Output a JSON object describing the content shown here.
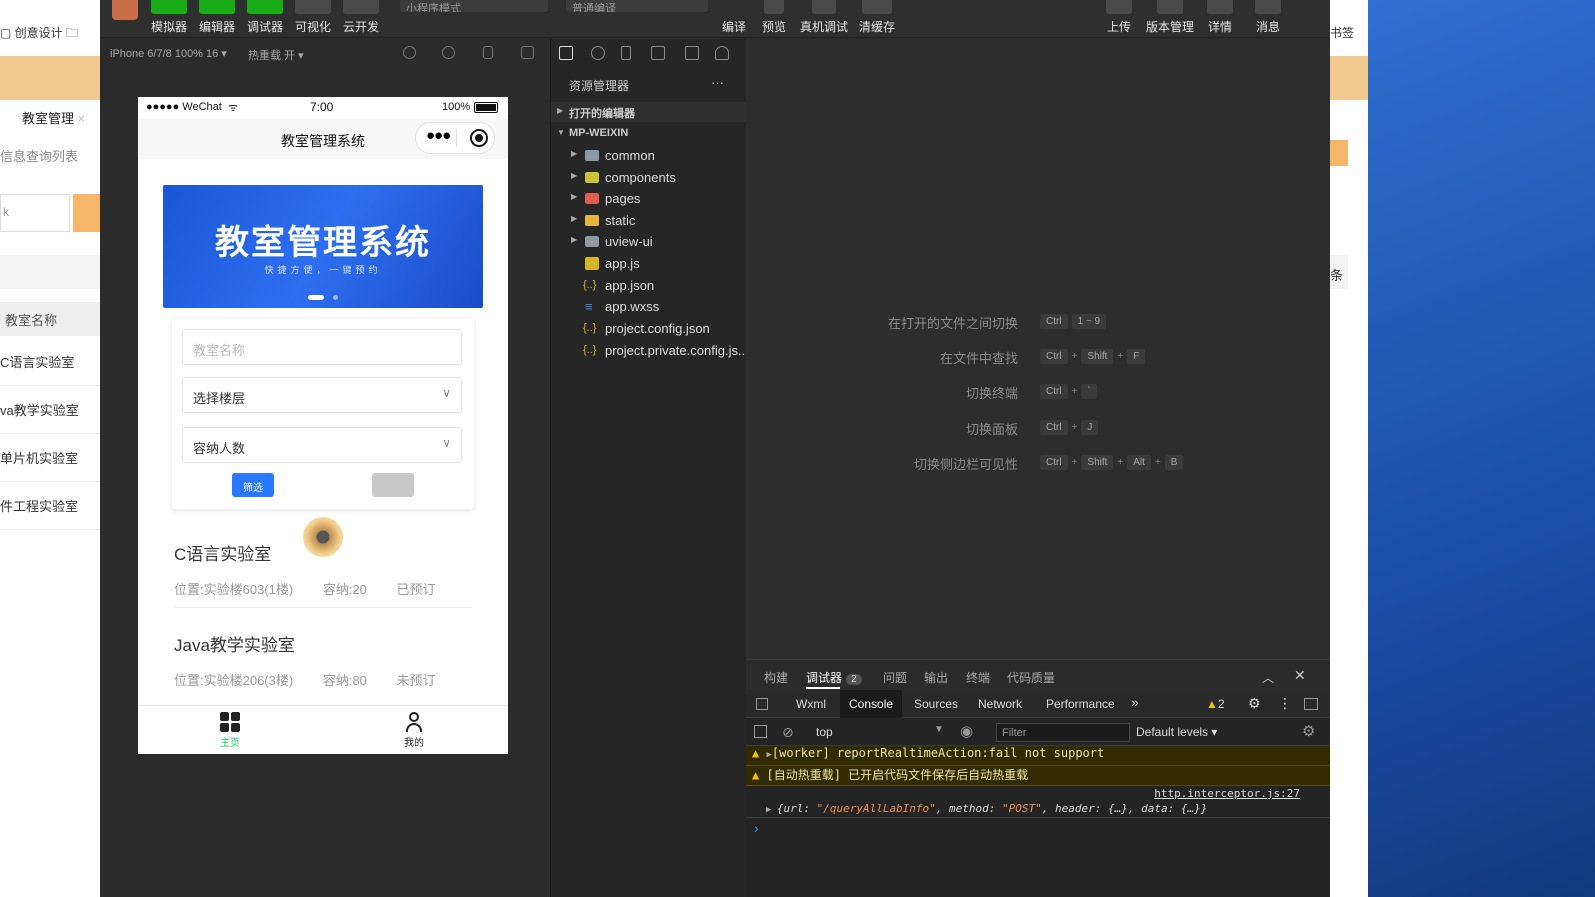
{
  "bg_browser": {
    "bookmark": "创意设计",
    "bookmark_right": "书签",
    "tab_label": "教室管理",
    "subtitle": "信息查询列表",
    "col_header": "教室名称",
    "col_header_right": "条",
    "rows": [
      "C语言实验室",
      "va教学实验室",
      "单片机实验室",
      "件工程实验室"
    ]
  },
  "toolbar": {
    "left": [
      "模拟器",
      "编辑器",
      "调试器",
      "可视化",
      "云开发"
    ],
    "mode_select": "小程序模式",
    "compile_select": "普通编译",
    "mid": [
      "编译",
      "预览",
      "真机调试",
      "清缓存"
    ],
    "right": [
      "上传",
      "版本管理",
      "详情",
      "消息"
    ]
  },
  "simbar": {
    "device": "iPhone 6/7/8 100% 16 ▾",
    "hot_reload": "热重载 开 ▾"
  },
  "phone": {
    "carrier": "●●●●● WeChat",
    "time": "7:00",
    "battery": "100%",
    "nav_title": "教室管理系统",
    "banner_title": "教室管理系统",
    "banner_sub": "快捷方便，一键预约",
    "name_placeholder": "教室名称",
    "floor_select": "选择楼层",
    "capacity_select": "容纳人数",
    "filter_btn": "筛选",
    "items": [
      {
        "name": "C语言实验室",
        "location": "位置:实验楼603(1楼)",
        "capacity": "容纳:20",
        "status": "已预订"
      },
      {
        "name": "Java教学实验室",
        "location": "位置:实验楼206(3楼)",
        "capacity": "容纳:80",
        "status": "未预订"
      }
    ],
    "tab_home": "主页",
    "tab_mine": "我的",
    "accent": "#2979ff",
    "tab_active_color": "#19be6b"
  },
  "explorer": {
    "title": "资源管理器",
    "open_editors": "打开的编辑器",
    "project": "MP-WEIXIN",
    "folders": [
      "common",
      "components",
      "pages",
      "static",
      "uview-ui"
    ],
    "files": [
      "app.js",
      "app.json",
      "app.wxss",
      "project.config.json",
      "project.private.config.js..."
    ]
  },
  "shortcuts": [
    {
      "label": "在打开的文件之间切换",
      "keys": [
        "Ctrl",
        "1 ~ 9"
      ]
    },
    {
      "label": "在文件中查找",
      "keys": [
        "Ctrl",
        "Shift",
        "F"
      ]
    },
    {
      "label": "切换终端",
      "keys": [
        "Ctrl",
        "`"
      ]
    },
    {
      "label": "切换面板",
      "keys": [
        "Ctrl",
        "J"
      ]
    },
    {
      "label": "切换侧边栏可见性",
      "keys": [
        "Ctrl",
        "Shift",
        "Alt",
        "B"
      ]
    }
  ],
  "debugger": {
    "tabs": [
      "构建",
      "调试器",
      "问题",
      "输出",
      "终端",
      "代码质量"
    ],
    "debugger_badge": "2",
    "devtools_tabs": [
      "Wxml",
      "Console",
      "Sources",
      "Network",
      "Performance"
    ],
    "more": "»",
    "warn_count": "2",
    "context": "top",
    "filter_placeholder": "Filter",
    "levels": "Default levels ▾",
    "logs": [
      "[worker] reportRealtimeAction:fail not support",
      "[自动热重载] 已开启代码文件保存后自动热重载"
    ],
    "log_source": "http.interceptor.js:27",
    "log_obj_prefix": "{url: ",
    "log_obj_url": "\"/queryAllLabInfo\"",
    "log_obj_mid": ", method: ",
    "log_obj_method": "\"POST\"",
    "log_obj_suffix": ", header: {…}, data: {…}}",
    "prompt": "›"
  }
}
